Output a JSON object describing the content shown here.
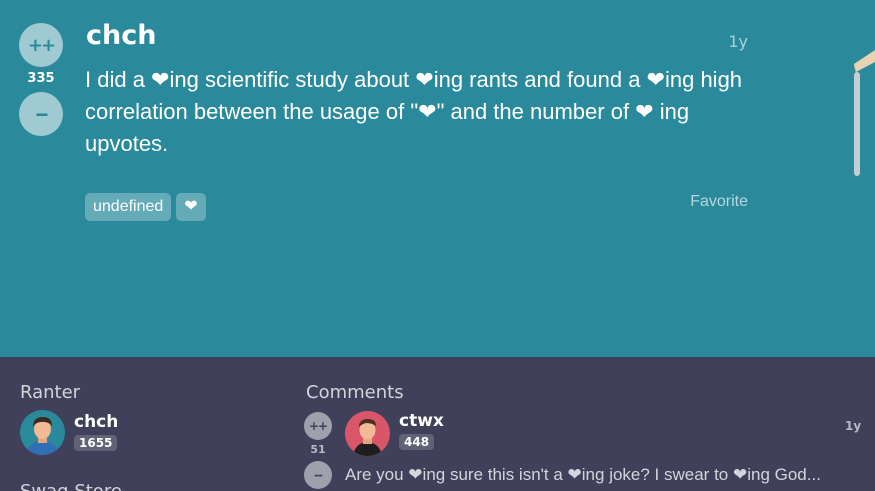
{
  "rant": {
    "upvote_label": "++",
    "downvote_label": "--",
    "score": "335",
    "username": "chch",
    "time": "1y",
    "text": "I did a ❤ing scientific study about ❤ing rants and found a ❤ing high correlation between the usage of \"❤\" and the number of ❤ ing upvotes.",
    "tags": [
      "undefined",
      "❤"
    ],
    "favorite_label": "Favorite"
  },
  "ranter": {
    "section_title": "Ranter",
    "username": "chch",
    "score": "1655",
    "next_section_partial": "Swag Store"
  },
  "comments": {
    "section_title": "Comments",
    "items": [
      {
        "upvote_label": "++",
        "downvote_label": "--",
        "score": "51",
        "username": "ctwx",
        "user_score": "448",
        "time": "1y",
        "text": "Are you ❤ing sure this isn't a ❤ing joke? I swear to ❤ing God..."
      }
    ]
  },
  "colors": {
    "rant_bg": "#2a8a9c",
    "footer_bg": "#40405a"
  }
}
